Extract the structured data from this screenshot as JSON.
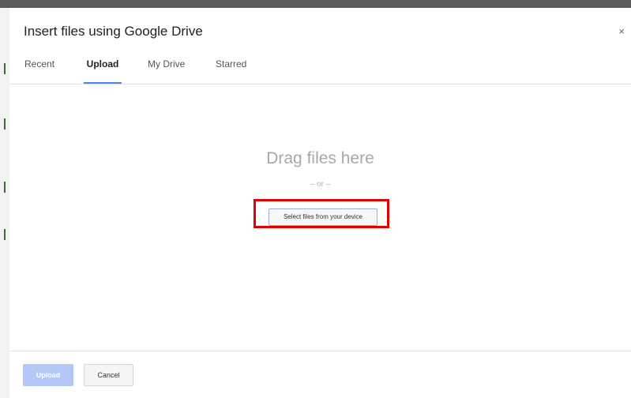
{
  "dialog": {
    "title": "Insert files using Google Drive",
    "close_label": "×"
  },
  "tabs": [
    {
      "label": "Recent",
      "active": false
    },
    {
      "label": "Upload",
      "active": true
    },
    {
      "label": "My Drive",
      "active": false
    },
    {
      "label": "Starred",
      "active": false
    }
  ],
  "dropzone": {
    "drag_text": "Drag files here",
    "or_text": "– or –",
    "select_button_label": "Select files from your device"
  },
  "footer": {
    "upload_label": "Upload",
    "cancel_label": "Cancel"
  },
  "colors": {
    "tab_underline": "#4285f4",
    "highlight_box": "#e00000",
    "upload_disabled": "#b3c8f6"
  }
}
